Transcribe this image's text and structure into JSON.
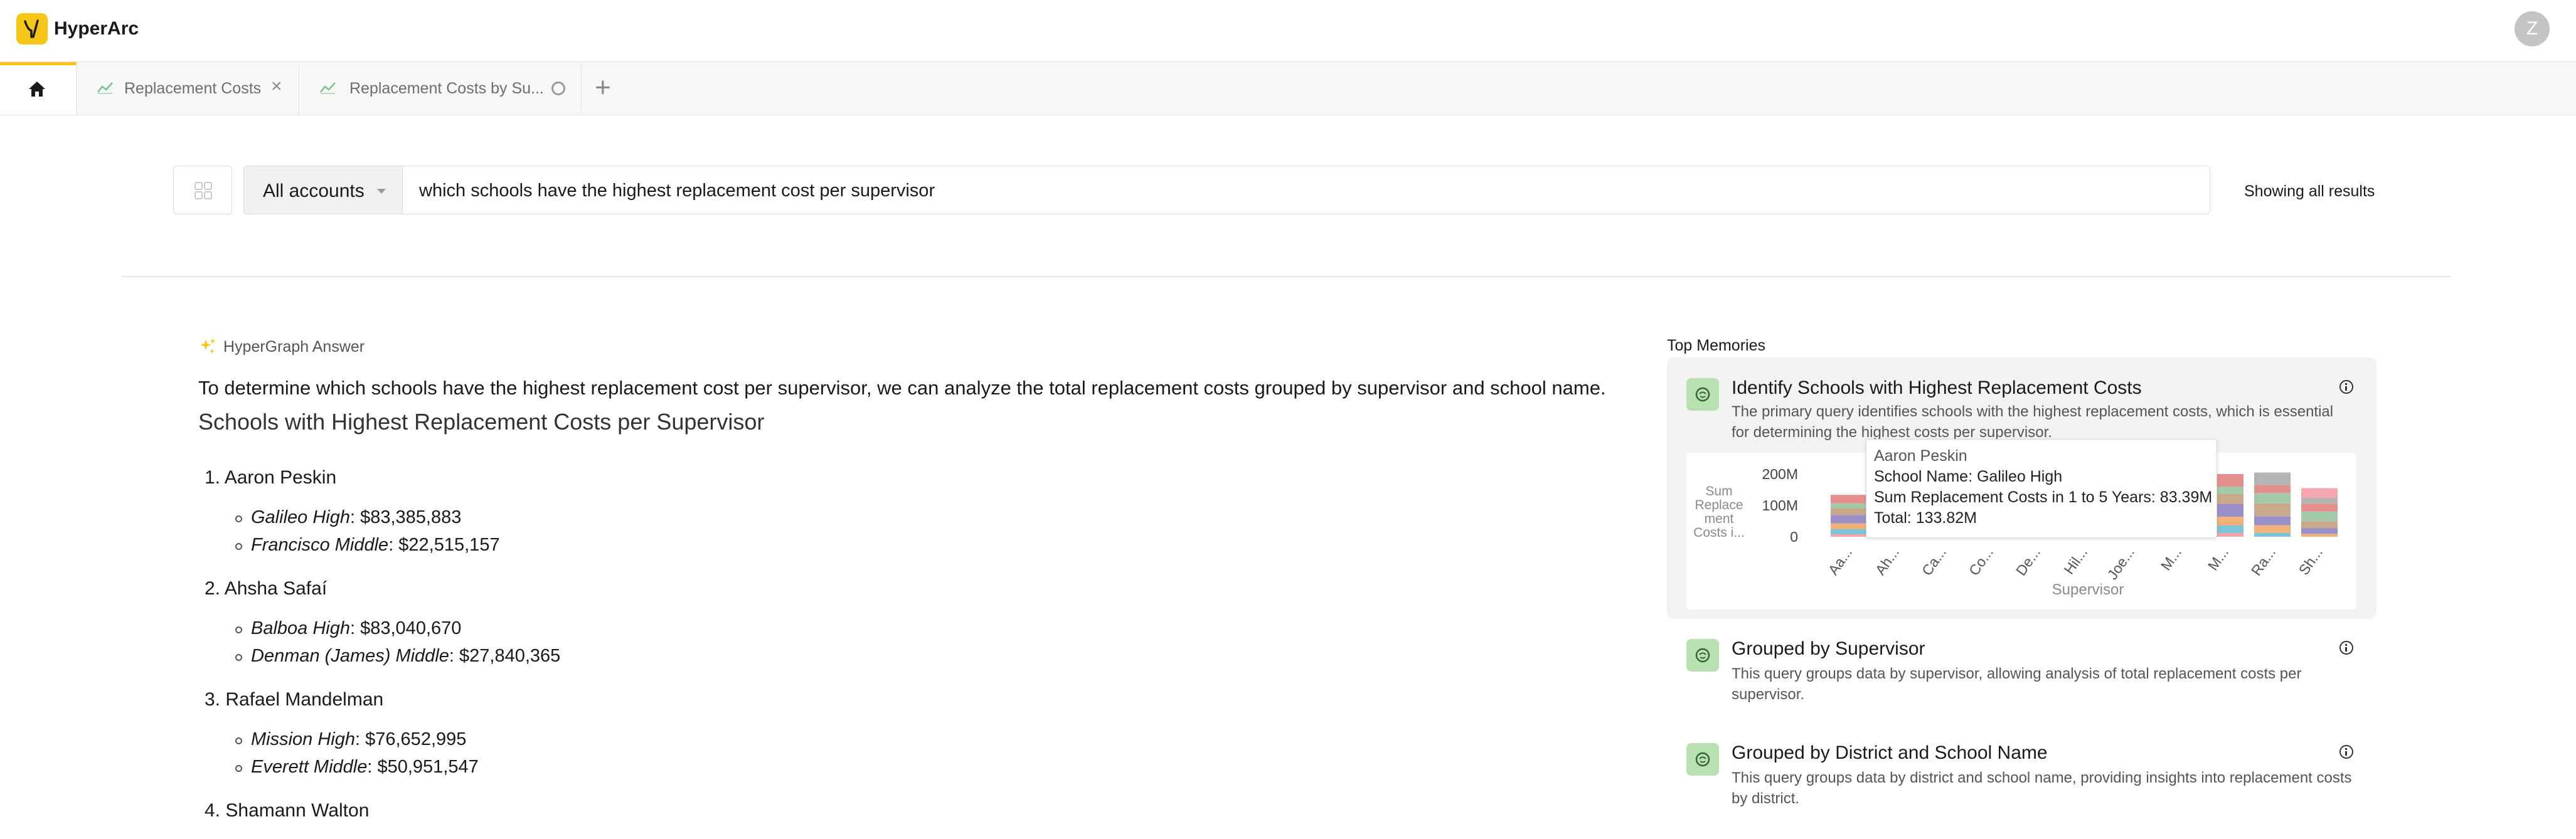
{
  "app": {
    "name": "HyperArc",
    "user_initial": "Z"
  },
  "tabs": [
    {
      "label": "Replacement Costs",
      "icon": "line-chart-icon",
      "action": "×"
    },
    {
      "label": "Replacement Costs by Su...",
      "icon": "line-chart-icon",
      "action": "loading"
    }
  ],
  "search": {
    "account": "All accounts",
    "query": "which schools have the highest replacement cost per supervisor",
    "results_note": "Showing all results"
  },
  "answer": {
    "tag": "HyperGraph Answer",
    "intro": "To determine which schools have the highest replacement cost per supervisor, we can analyze the total replacement costs grouped by supervisor and school name.",
    "heading": "Schools with Highest Replacement Costs per Supervisor",
    "supervisors": [
      {
        "rank": "1.",
        "name": "Aaron Peskin",
        "schools": [
          {
            "name": "Galileo High",
            "cost": ": $83,385,883"
          },
          {
            "name": "Francisco Middle",
            "cost": ": $22,515,157"
          }
        ]
      },
      {
        "rank": "2.",
        "name": "Ahsha Safaí",
        "schools": [
          {
            "name": "Balboa High",
            "cost": ": $83,040,670"
          },
          {
            "name": "Denman (James) Middle",
            "cost": ": $27,840,365"
          }
        ]
      },
      {
        "rank": "3.",
        "name": "Rafael Mandelman",
        "schools": [
          {
            "name": "Mission High",
            "cost": ": $76,652,995"
          },
          {
            "name": "Everett Middle",
            "cost": ": $50,951,547"
          }
        ]
      },
      {
        "rank": "4.",
        "name": "Shamann Walton",
        "schools": []
      }
    ]
  },
  "memories": {
    "title": "Top Memories",
    "items": [
      {
        "name": "Identify Schools with Highest Replacement Costs",
        "desc": "The primary query identifies schools with the highest replacement costs, which is essential for determining the highest costs per supervisor."
      },
      {
        "name": "Grouped by Supervisor",
        "desc": "This query groups data by supervisor, allowing analysis of total replacement costs per supervisor."
      },
      {
        "name": "Grouped by District and School Name",
        "desc": "This query groups data by district and school name, providing insights into replacement costs by district."
      }
    ]
  },
  "tooltip": {
    "name": "Aaron Peskin",
    "school": "School Name: Galileo High",
    "metric": "Sum Replacement Costs in 1 to 5 Years: 83.39M",
    "total": "Total: 133.82M"
  },
  "chart_data": {
    "type": "bar",
    "stacked": true,
    "xlabel": "Supervisor",
    "ylabel": "Sum Replace ment Costs i...",
    "ylabel_lines": [
      "Sum",
      "Replace",
      "ment",
      "Costs i..."
    ],
    "ytick_labels": [
      "200M",
      "100M",
      "0"
    ],
    "ylim": [
      0,
      200
    ],
    "categories": [
      "Aa...",
      "Ah...",
      "Ca...",
      "Co...",
      "De...",
      "Hil...",
      "Joe...",
      "M...",
      "M...",
      "Ra...",
      "Sh..."
    ],
    "totals": [
      133.82,
      0,
      0,
      0,
      0,
      0,
      0,
      0,
      200,
      205,
      155
    ],
    "segment_colors": [
      "#f4a6ae",
      "#7dc4d8",
      "#f0b27a",
      "#9b8fc9",
      "#c9a98b",
      "#a3c9a8",
      "#e58f8f",
      "#b4b4b4"
    ],
    "visible_bar_indexes": [
      0,
      8,
      9,
      10
    ]
  }
}
